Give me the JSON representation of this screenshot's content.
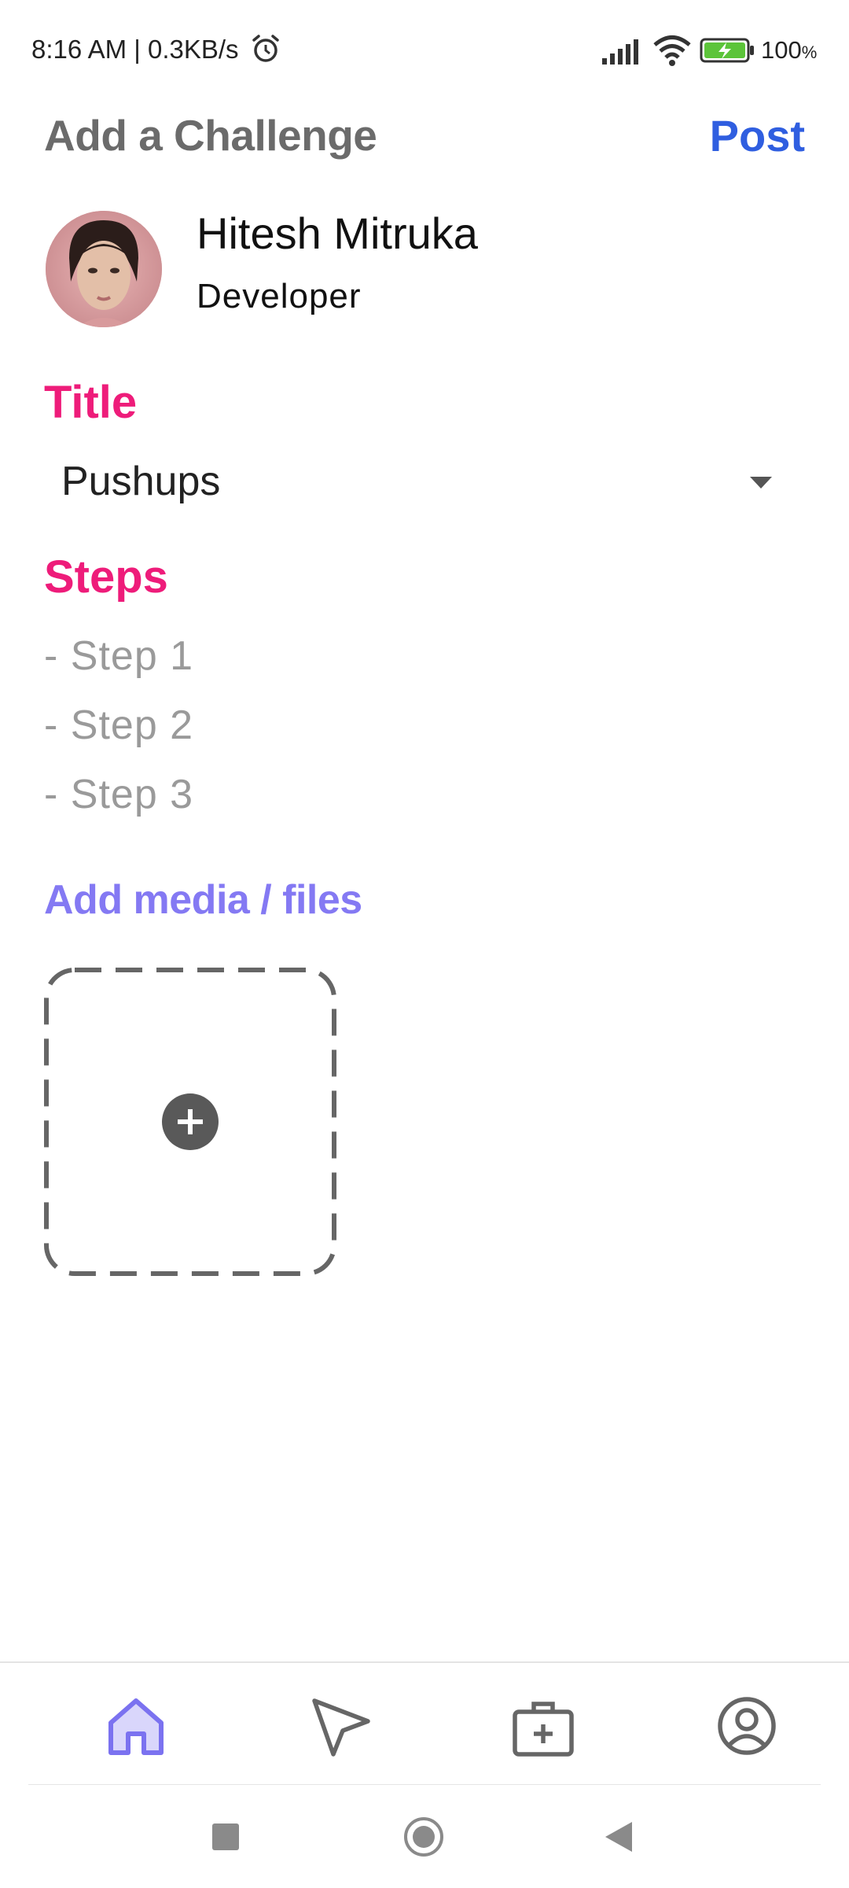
{
  "status_bar": {
    "time": "8:16 AM | 0.3KB/s",
    "battery_text": "100",
    "battery_unit": "%",
    "icons": [
      "alarm-icon",
      "signal-icon",
      "wifi-icon",
      "battery-charging-icon"
    ]
  },
  "header": {
    "title": "Add a Challenge",
    "post_label": "Post"
  },
  "user": {
    "name": "Hitesh Mitruka",
    "role": "Developer"
  },
  "title_section": {
    "label": "Title",
    "selected_value": "Pushups"
  },
  "steps_section": {
    "label": "Steps",
    "items": [
      "- Step 1",
      "- Step 2",
      "- Step 3"
    ]
  },
  "media_section": {
    "label": "Add media / files",
    "add_icon": "plus-circle-icon"
  },
  "bottom_nav": {
    "items": [
      {
        "icon": "home-icon",
        "active": true
      },
      {
        "icon": "send-icon",
        "active": false
      },
      {
        "icon": "briefcase-plus-icon",
        "active": false
      },
      {
        "icon": "account-icon",
        "active": false
      }
    ]
  },
  "colors": {
    "accent_title": "#ee1c7a",
    "accent_media": "#8479f3",
    "post_blue": "#2f5ee0",
    "nav_active": "#7b72f0",
    "heading_gray": "#6b6b6b"
  }
}
